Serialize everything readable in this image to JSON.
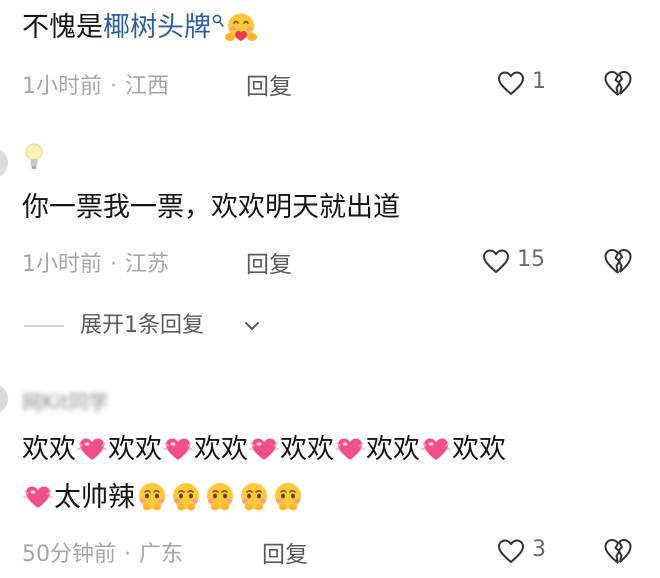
{
  "comments": [
    {
      "text_plain": "不愧是",
      "topic_link": "椰树头牌",
      "time": "1小时前",
      "location": "江西",
      "reply_label": "回复",
      "like_count": "1"
    },
    {
      "text": "你一票我一票，欢欢明天就出道",
      "time": "1小时前",
      "location": "江苏",
      "reply_label": "回复",
      "like_count": "15",
      "expand_replies_label": "展开1条回复"
    },
    {
      "username": "网Kit同学",
      "segments": [
        "欢欢",
        "欢欢",
        "欢欢",
        "欢欢",
        "欢欢",
        "欢欢",
        "太帅辣"
      ],
      "time": "50分钟前",
      "location": "广东",
      "reply_label": "回复",
      "like_count": "3"
    }
  ],
  "meta_separator": "·",
  "icons": {
    "like": "heart-outline-icon",
    "dislike": "broken-heart-icon",
    "expand": "chevron-down-icon",
    "topic_search": "search-icon",
    "emoji_hug": "hugging-face-emoji",
    "emoji_heart": "pink-heart-emoji",
    "emoji_shy": "shy-face-emoji"
  },
  "colors": {
    "topic_link": "#2f5e9e",
    "meta_gray": "#a6a6a6",
    "heart_pink": "#f0508a"
  }
}
